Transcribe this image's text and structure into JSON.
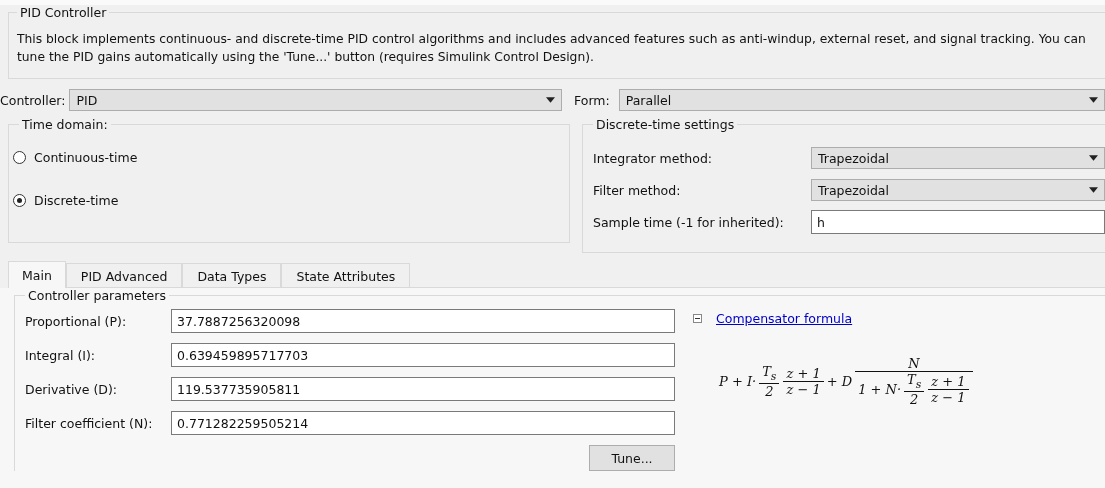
{
  "block": {
    "title": "PID Controller",
    "description": "This block implements continuous- and discrete-time PID control algorithms and includes advanced features such as anti-windup, external reset, and signal tracking. You can tune the PID gains automatically using the 'Tune...' button (requires Simulink Control Design)."
  },
  "controller": {
    "label": "Controller:",
    "value": "PID"
  },
  "form": {
    "label": "Form:",
    "value": "Parallel"
  },
  "time_domain": {
    "title": "Time domain:",
    "options": [
      {
        "label": "Continuous-time",
        "selected": false
      },
      {
        "label": "Discrete-time",
        "selected": true
      }
    ]
  },
  "discrete_settings": {
    "title": "Discrete-time settings",
    "rows": [
      {
        "kind": "dropdown",
        "label": "Integrator method:",
        "value": "Trapezoidal"
      },
      {
        "kind": "dropdown",
        "label": "Filter method:",
        "value": "Trapezoidal"
      },
      {
        "kind": "input",
        "label": "Sample time (-1 for inherited):",
        "value": "h"
      }
    ]
  },
  "tabs": [
    {
      "label": "Main",
      "selected": true
    },
    {
      "label": "PID Advanced",
      "selected": false
    },
    {
      "label": "Data Types",
      "selected": false
    },
    {
      "label": "State Attributes",
      "selected": false
    }
  ],
  "parameters": {
    "title": "Controller parameters",
    "rows": [
      {
        "label": "Proportional (P):",
        "value": "37.7887256320098"
      },
      {
        "label": "Integral (I):",
        "value": "0.639459895717703"
      },
      {
        "label": "Derivative (D):",
        "value": "119.537735905811"
      },
      {
        "label": "Filter coefficient (N):",
        "value": "0.771282259505214"
      }
    ],
    "tune_button": "Tune..."
  },
  "compensator": {
    "expanded": true,
    "link": "Compensator formula",
    "formula": [
      {
        "kind": "text",
        "text": "P + I·"
      },
      {
        "kind": "frac",
        "num": [
          {
            "kind": "text",
            "text": "T$_{s}$"
          }
        ],
        "den": [
          {
            "kind": "text",
            "text": "2"
          }
        ]
      },
      {
        "kind": "frac",
        "num": [
          {
            "kind": "text",
            "text": "z + 1"
          }
        ],
        "den": [
          {
            "kind": "text",
            "text": "z − 1"
          }
        ]
      },
      {
        "kind": "text",
        "text": "+ D"
      },
      {
        "kind": "frac",
        "num": [
          {
            "kind": "text",
            "text": "N"
          }
        ],
        "den": [
          {
            "kind": "text",
            "text": "1 + N·"
          },
          {
            "kind": "frac",
            "num": [
              {
                "kind": "text",
                "text": "T$_{s}$"
              }
            ],
            "den": [
              {
                "kind": "text",
                "text": "2"
              }
            ]
          },
          {
            "kind": "frac",
            "num": [
              {
                "kind": "text",
                "text": "z + 1"
              }
            ],
            "den": [
              {
                "kind": "text",
                "text": "z − 1"
              }
            ]
          }
        ]
      }
    ]
  }
}
